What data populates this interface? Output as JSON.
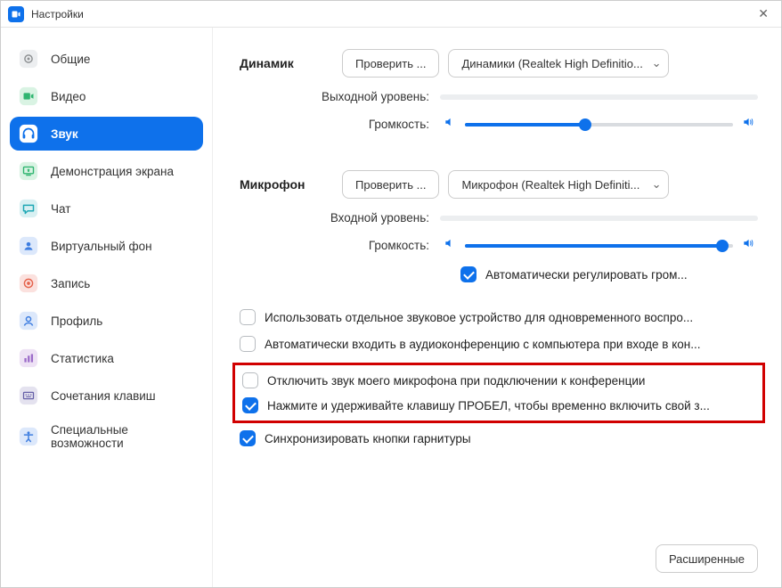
{
  "window": {
    "title": "Настройки"
  },
  "sidebar": {
    "items": [
      {
        "label": "Общие"
      },
      {
        "label": "Видео"
      },
      {
        "label": "Звук"
      },
      {
        "label": "Демонстрация экрана"
      },
      {
        "label": "Чат"
      },
      {
        "label": "Виртуальный фон"
      },
      {
        "label": "Запись"
      },
      {
        "label": "Профиль"
      },
      {
        "label": "Статистика"
      },
      {
        "label": "Сочетания клавиш"
      },
      {
        "label": "Специальные возможности"
      }
    ]
  },
  "speaker": {
    "section": "Динамик",
    "test": "Проверить ...",
    "device": "Динамики (Realtek High Definitio...",
    "outputLevelLabel": "Выходной уровень:",
    "volumeLabel": "Громкость:",
    "volumePercent": 45
  },
  "mic": {
    "section": "Микрофон",
    "test": "Проверить ...",
    "device": "Микрофон (Realtek High Definiti...",
    "inputLevelLabel": "Входной уровень:",
    "volumeLabel": "Громкость:",
    "volumePercent": 96,
    "autoAdjust": "Автоматически регулировать гром..."
  },
  "options": {
    "separateDevice": "Использовать отдельное звуковое устройство для одновременного воспро...",
    "autoJoin": "Автоматически входить в аудиоконференцию с компьютера при входе в кон...",
    "muteOnJoin": "Отключить звук моего микрофона при подключении к конференции",
    "pushToTalk": "Нажмите и удерживайте клавишу ПРОБЕЛ, чтобы временно включить свой з...",
    "syncHeadset": "Синхронизировать кнопки гарнитуры"
  },
  "footer": {
    "advanced": "Расширенные"
  }
}
